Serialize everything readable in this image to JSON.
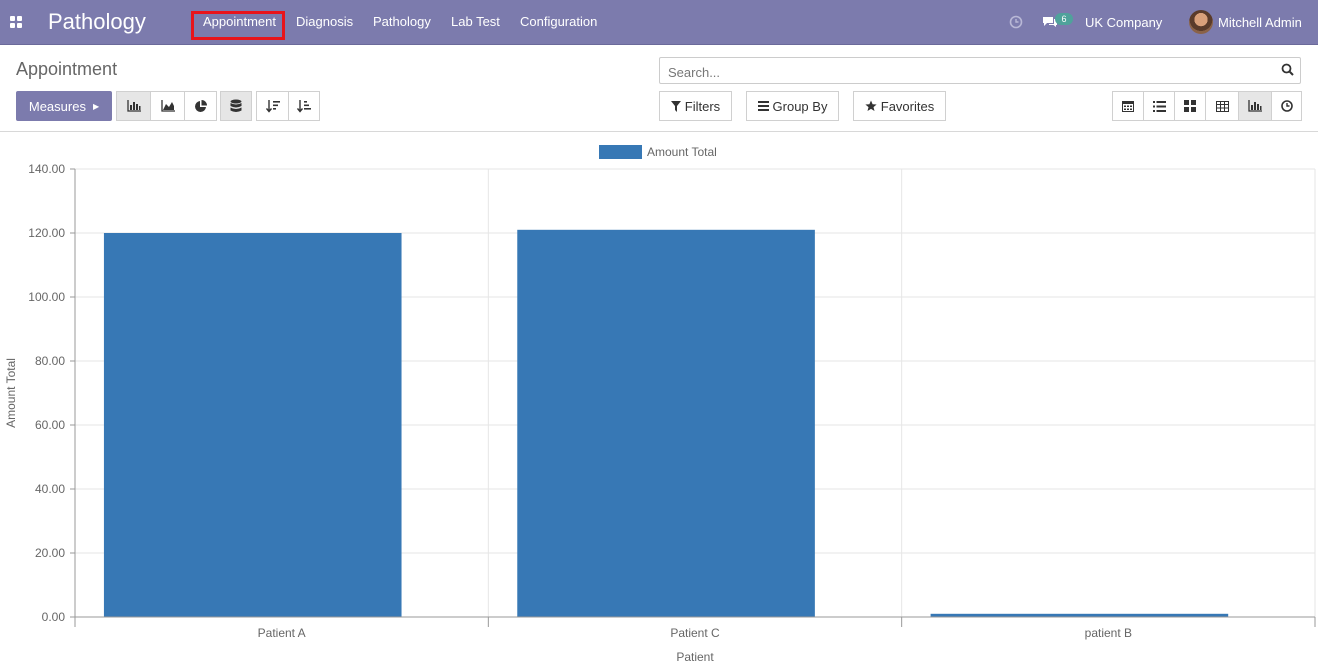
{
  "navbar": {
    "app_title": "Pathology",
    "menu": [
      "Appointment",
      "Diagnosis",
      "Pathology",
      "Lab Test",
      "Configuration"
    ],
    "active_menu": "Appointment",
    "messages_count": "6",
    "company": "UK Company",
    "user": "Mitchell Admin",
    "highlight_color": "#e8141b",
    "bar_color": "#7c7bad"
  },
  "control_panel": {
    "breadcrumb": "Appointment",
    "search_placeholder": "Search...",
    "measures_label": "Measures",
    "filters_label": "Filters",
    "group_by_label": "Group By",
    "favorites_label": "Favorites",
    "chart_type_buttons": [
      "bar-chart-icon",
      "line-chart-icon",
      "pie-chart-icon"
    ],
    "stacked_icon": "database-icon",
    "sort_icons": [
      "sort-descending-icon",
      "sort-ascending-icon"
    ],
    "view_switcher": [
      "calendar-icon",
      "list-icon",
      "kanban-icon",
      "pivot-icon",
      "graph-icon",
      "activity-icon"
    ],
    "active_view": "graph-icon"
  },
  "chart_data": {
    "type": "bar",
    "categories": [
      "Patient A",
      "Patient C",
      "patient B"
    ],
    "series": [
      {
        "name": "Amount Total",
        "values": [
          120,
          121,
          1
        ],
        "color": "#3778b5"
      }
    ],
    "xlabel": "Patient",
    "ylabel": "Amount Total",
    "ylim": [
      0,
      140
    ],
    "yticks": [
      "0.00",
      "20.00",
      "40.00",
      "60.00",
      "80.00",
      "100.00",
      "120.00",
      "140.00"
    ],
    "grid": true,
    "legend_position": "top-center"
  }
}
